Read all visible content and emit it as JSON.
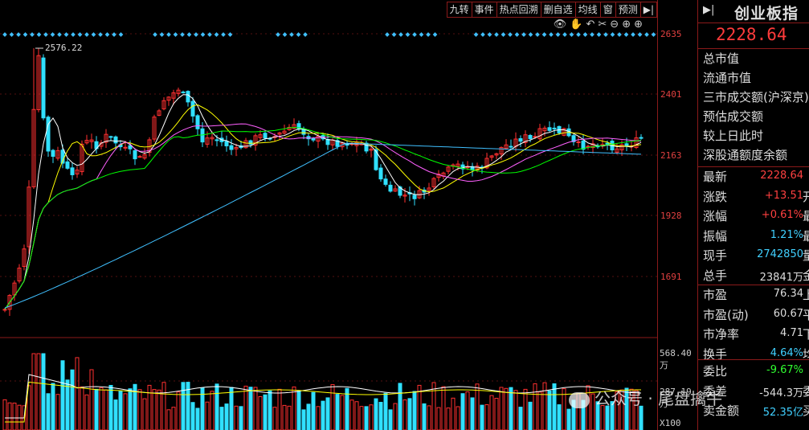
{
  "toolbar": [
    "九转",
    "事件",
    "热点回溯",
    "删自选",
    "均线",
    "窗",
    "预测",
    "▶|"
  ],
  "tools": [
    "👁",
    "✋",
    "↶",
    "✂",
    "⊖",
    "⊕",
    "⊕"
  ],
  "axis": {
    "price_labels": [
      "2635",
      "2401",
      "2163",
      "1928",
      "1691"
    ],
    "volume_top": "568.40万",
    "volume_mid": "287.19万",
    "volume_unit": "X100"
  },
  "chart": {
    "peak_label": "2576.22",
    "colors": {
      "up": "#ff3030",
      "down": "#30e0ff",
      "ma5": "#ffffff",
      "ma10": "#ffff00",
      "ma20": "#ff60ff",
      "ma30": "#00ff00",
      "ma60": "#40c0ff"
    }
  },
  "info": {
    "arrow": "▶|",
    "name": "创业板指",
    "price": "2228.64",
    "labels": [
      "总市值",
      "流通市值",
      "三市成交额(沪深京)",
      "预估成交额",
      "较上日此时",
      "深股通额度余额"
    ],
    "rows": [
      {
        "k": "最新",
        "v": "2228.64",
        "color": "#ff4040",
        "s": ""
      },
      {
        "k": "涨跌",
        "v": "+13.51",
        "color": "#ff4040",
        "s": "开"
      },
      {
        "k": "涨幅",
        "v": "+0.61%",
        "color": "#ff4040",
        "s": "最"
      },
      {
        "k": "振幅",
        "v": "1.21%",
        "color": "#40d0ff",
        "s": "最"
      },
      {
        "k": "现手",
        "v": "2742850",
        "color": "#40d0ff",
        "s": "量"
      },
      {
        "k": "总手",
        "v": "23841万",
        "color": "#dddddd",
        "s": "金"
      }
    ],
    "rows2": [
      {
        "k": "市盈",
        "v": "76.34",
        "color": "#dddddd",
        "s": "上"
      },
      {
        "k": "市盈(动)",
        "v": "60.67",
        "color": "#dddddd",
        "s": "平"
      },
      {
        "k": "市净率",
        "v": "4.71",
        "color": "#dddddd",
        "s": "下"
      },
      {
        "k": "换手",
        "v": "4.64%",
        "color": "#40d0ff",
        "s": "均"
      }
    ],
    "rows3": [
      {
        "k": "委比",
        "v": "-9.67%",
        "color": "#30ff30",
        "s": ""
      },
      {
        "k": "委差",
        "v": "-544.3万",
        "color": "#dddddd",
        "s": "委"
      },
      {
        "k": "卖金额",
        "v": "52.35亿",
        "color": "#40d0ff",
        "s": "买"
      }
    ]
  },
  "watermark": "公众号 · 尾盘擒牛"
}
